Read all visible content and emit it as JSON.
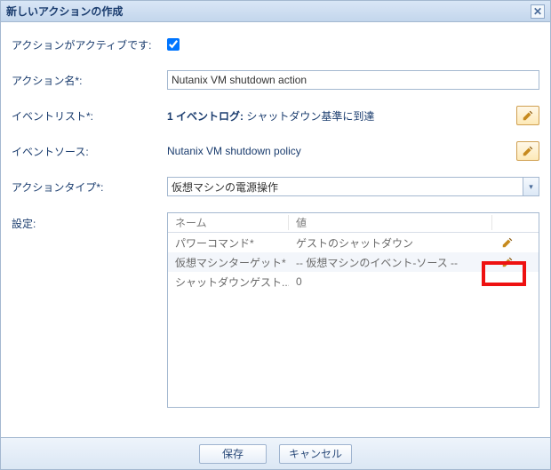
{
  "title": "新しいアクションの作成",
  "labels": {
    "active": "アクションがアクティブです:",
    "action_name": "アクション名*:",
    "event_list": "イベントリスト*:",
    "event_source": "イベントソース:",
    "action_type": "アクションタイプ*:",
    "settings": "設定:"
  },
  "values": {
    "active_checked": true,
    "action_name": "Nutanix VM shutdown action",
    "event_list_prefix": "1 イベントログ:",
    "event_list_text": " シャットダウン基準に到達",
    "event_source": "Nutanix VM shutdown policy",
    "action_type": "仮想マシンの電源操作"
  },
  "grid": {
    "headers": {
      "name": "ネーム",
      "value": "値"
    },
    "rows": [
      {
        "name": "パワーコマンド*",
        "value": "ゲストのシャットダウン",
        "editable": true
      },
      {
        "name": "仮想マシンターゲット*",
        "value": "-- 仮想マシンのイベント-ソース --",
        "editable": true
      },
      {
        "name": "シャットダウンゲスト...",
        "value": "0",
        "editable": false
      }
    ]
  },
  "buttons": {
    "save": "保存",
    "cancel": "キャンセル"
  },
  "close_glyph": "✕"
}
